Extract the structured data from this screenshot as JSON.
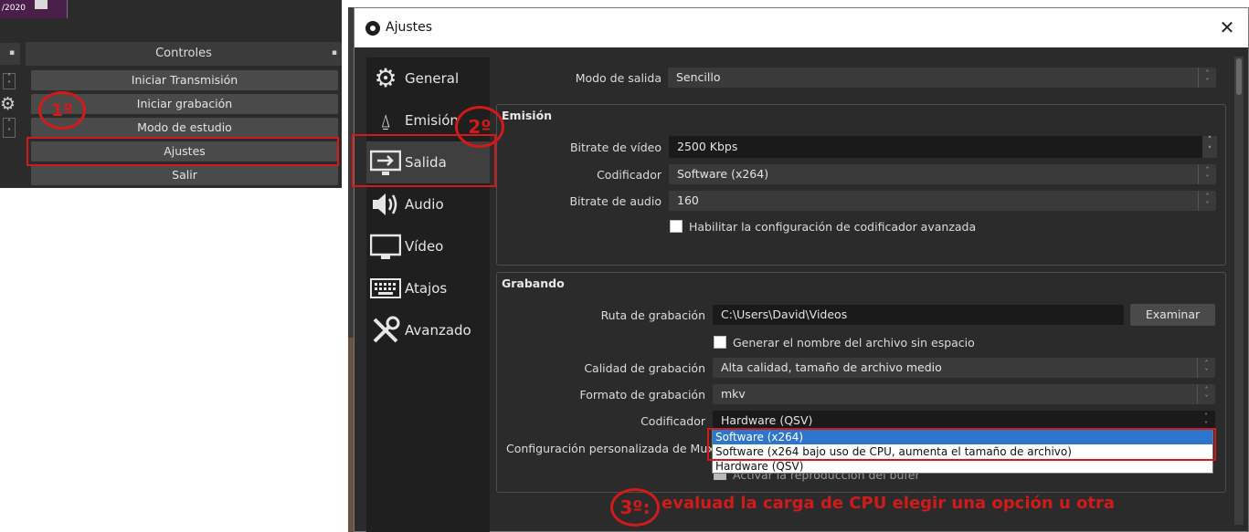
{
  "left_panel": {
    "preview_date": "/2020",
    "controls_title": "Controles",
    "buttons": [
      "Iniciar Transmisión",
      "Iniciar grabación",
      "Modo de estudio",
      "Ajustes",
      "Salir"
    ]
  },
  "annotations": {
    "step1": "1º",
    "step2": "2º",
    "step3": "3º:",
    "step3_text": "evaluad la carga de CPU elegir una opción u otra"
  },
  "dialog": {
    "title": "Ajustes",
    "close_icon": "close-icon",
    "sidebar": [
      {
        "label": "General",
        "icon": "gear-icon"
      },
      {
        "label": "Emisión",
        "icon": "antenna-icon"
      },
      {
        "label": "Salida",
        "icon": "monitor-output-icon"
      },
      {
        "label": "Audio",
        "icon": "speaker-icon"
      },
      {
        "label": "Vídeo",
        "icon": "monitor-icon"
      },
      {
        "label": "Atajos",
        "icon": "keyboard-icon"
      },
      {
        "label": "Avanzado",
        "icon": "tools-icon"
      }
    ],
    "selected": "Salida",
    "output_mode_label": "Modo de salida",
    "output_mode_value": "Sencillo",
    "streaming": {
      "title": "Emisión",
      "video_bitrate_label": "Bitrate de vídeo",
      "video_bitrate_value": "2500 Kbps",
      "encoder_label": "Codificador",
      "encoder_value": "Software (x264)",
      "audio_bitrate_label": "Bitrate de audio",
      "audio_bitrate_value": "160",
      "advanced_label": "Habilitar la configuración de codificador avanzada"
    },
    "recording": {
      "title": "Grabando",
      "path_label": "Ruta de grabación",
      "path_value": "C:\\Users\\David\\Videos",
      "browse_label": "Examinar",
      "nospace_label": "Generar el nombre del archivo sin espacio",
      "quality_label": "Calidad de grabación",
      "quality_value": "Alta calidad, tamaño de archivo medio",
      "format_label": "Formato de grabación",
      "format_value": "mkv",
      "encoder_label": "Codificador",
      "encoder_value": "Hardware (QSV)",
      "muxer_label": "Configuración personalizada de Muxer",
      "replay_label": "Activar la reproducción del búfer",
      "encoder_options": [
        "Software (x264)",
        "Software (x264 bajo uso de CPU, aumenta el tamaño de archivo)",
        "Hardware (QSV)"
      ]
    }
  },
  "colors": {
    "annotation_red": "#d11a1a",
    "dropdown_highlight": "#2e75cc",
    "panel_bg": "#2b2b2b"
  }
}
